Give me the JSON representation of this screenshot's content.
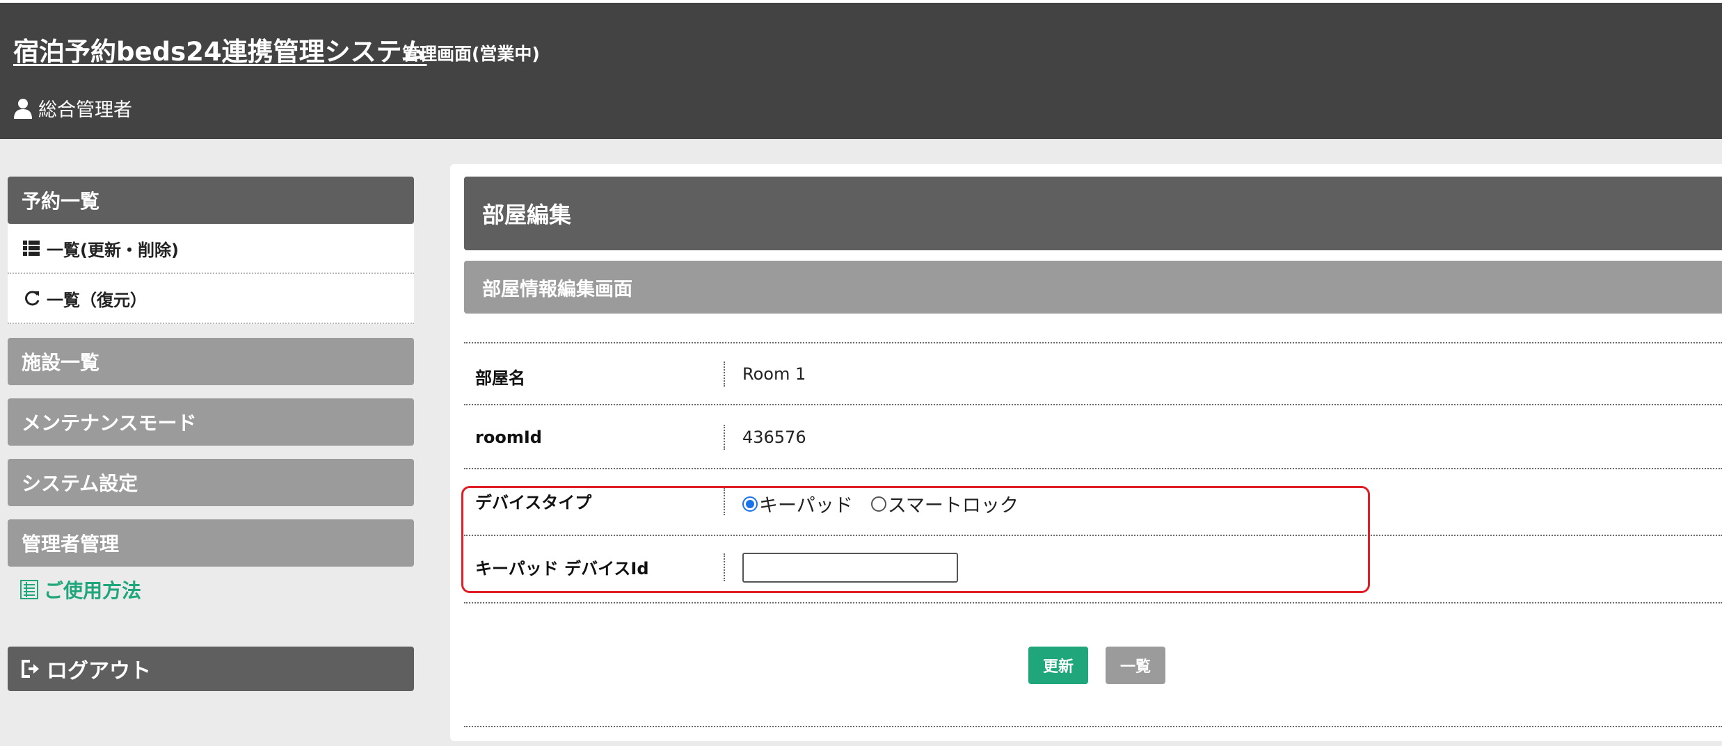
{
  "header": {
    "title": "宿泊予約beds24連携管理システム",
    "subtitle": "管理画面(営業中)",
    "user_icon": "user-icon",
    "user_name": "総合管理者"
  },
  "sidebar": {
    "reservations_heading": "予約一覧",
    "reservations_items": [
      {
        "icon": "list-icon",
        "label": "一覧(更新・削除)"
      },
      {
        "icon": "refresh-icon",
        "label": "一覧（復元）"
      }
    ],
    "facilities": "施設一覧",
    "maintenance": "メンテナンスモード",
    "system_settings": "システム設定",
    "admin_management": "管理者管理",
    "help": {
      "icon": "document-icon",
      "label": "ご使用方法"
    },
    "logout": {
      "icon": "logout-icon",
      "label": "ログアウト"
    }
  },
  "main": {
    "section_title": "部屋編集",
    "sub_title": "部屋情報編集画面",
    "fields": {
      "room_name": {
        "label": "部屋名",
        "value": "Room 1"
      },
      "room_id": {
        "label": "roomId",
        "value": "436576"
      },
      "device_type": {
        "label": "デバイスタイプ",
        "options": [
          "キーパッド",
          "スマートロック"
        ],
        "selected": "キーパッド"
      },
      "keypad_device_id": {
        "label": "キーパッド デバイスId",
        "value": ""
      }
    },
    "buttons": {
      "update": "更新",
      "list": "一覧"
    }
  },
  "colors": {
    "header_bg": "#434343",
    "heading_dark": "#5f5f5f",
    "heading_light": "#9b9b9b",
    "accent_green": "#1fa67a",
    "highlight_red": "#e01e26"
  }
}
